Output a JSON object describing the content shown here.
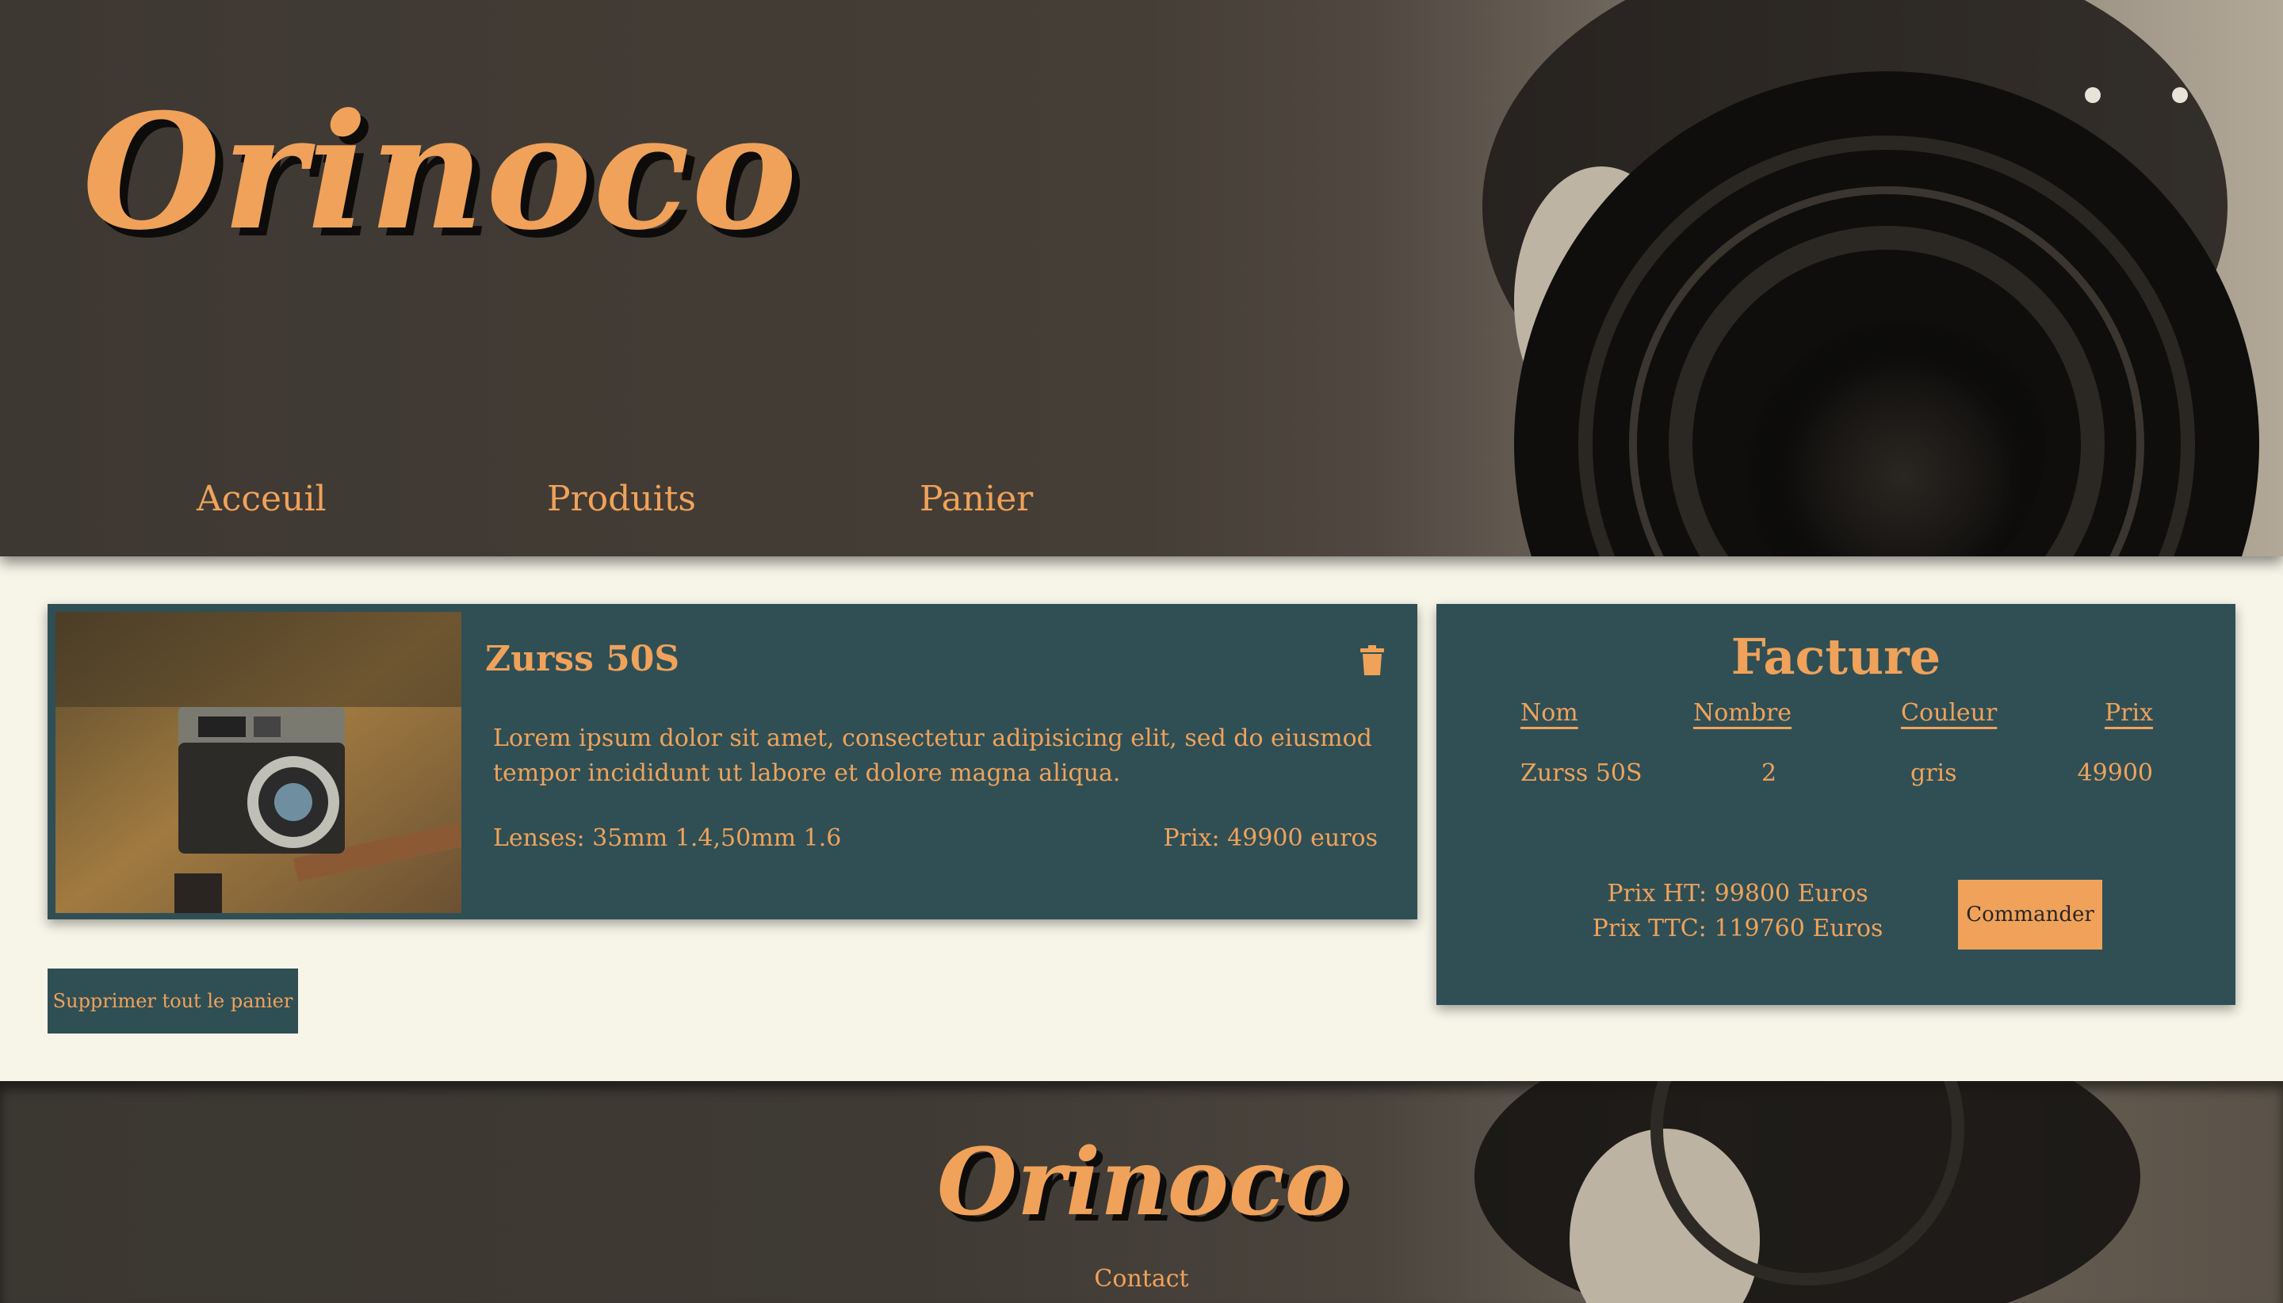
{
  "header": {
    "brand": "Orinoco",
    "nav": [
      "Acceuil",
      "Produits",
      "Panier"
    ]
  },
  "cart": {
    "item": {
      "name": "Zurss 50S",
      "description": "Lorem ipsum dolor sit amet, consectetur adipisicing elit, sed do eiusmod tempor incididunt ut labore et dolore magna aliqua.",
      "lenses": "Lenses: 35mm 1.4,50mm 1.6",
      "price": "Prix: 49900 euros"
    },
    "clear_label": "Supprimer tout le panier"
  },
  "invoice": {
    "title": "Facture",
    "columns": [
      "Nom",
      "Nombre",
      "Couleur",
      "Prix"
    ],
    "rows": [
      {
        "nom": "Zurss 50S",
        "nombre": "2",
        "couleur": "gris",
        "prix": "49900"
      }
    ],
    "prix_ht": "Prix HT: 99800 Euros",
    "prix_ttc": "Prix TTC: 119760 Euros",
    "order_label": "Commander"
  },
  "footer": {
    "brand": "Orinoco",
    "contact": "Contact"
  },
  "colors": {
    "accent": "#f0a25a",
    "panel": "#2f4f55",
    "background": "#f7f5e8"
  },
  "icons": [
    "trash-icon"
  ]
}
